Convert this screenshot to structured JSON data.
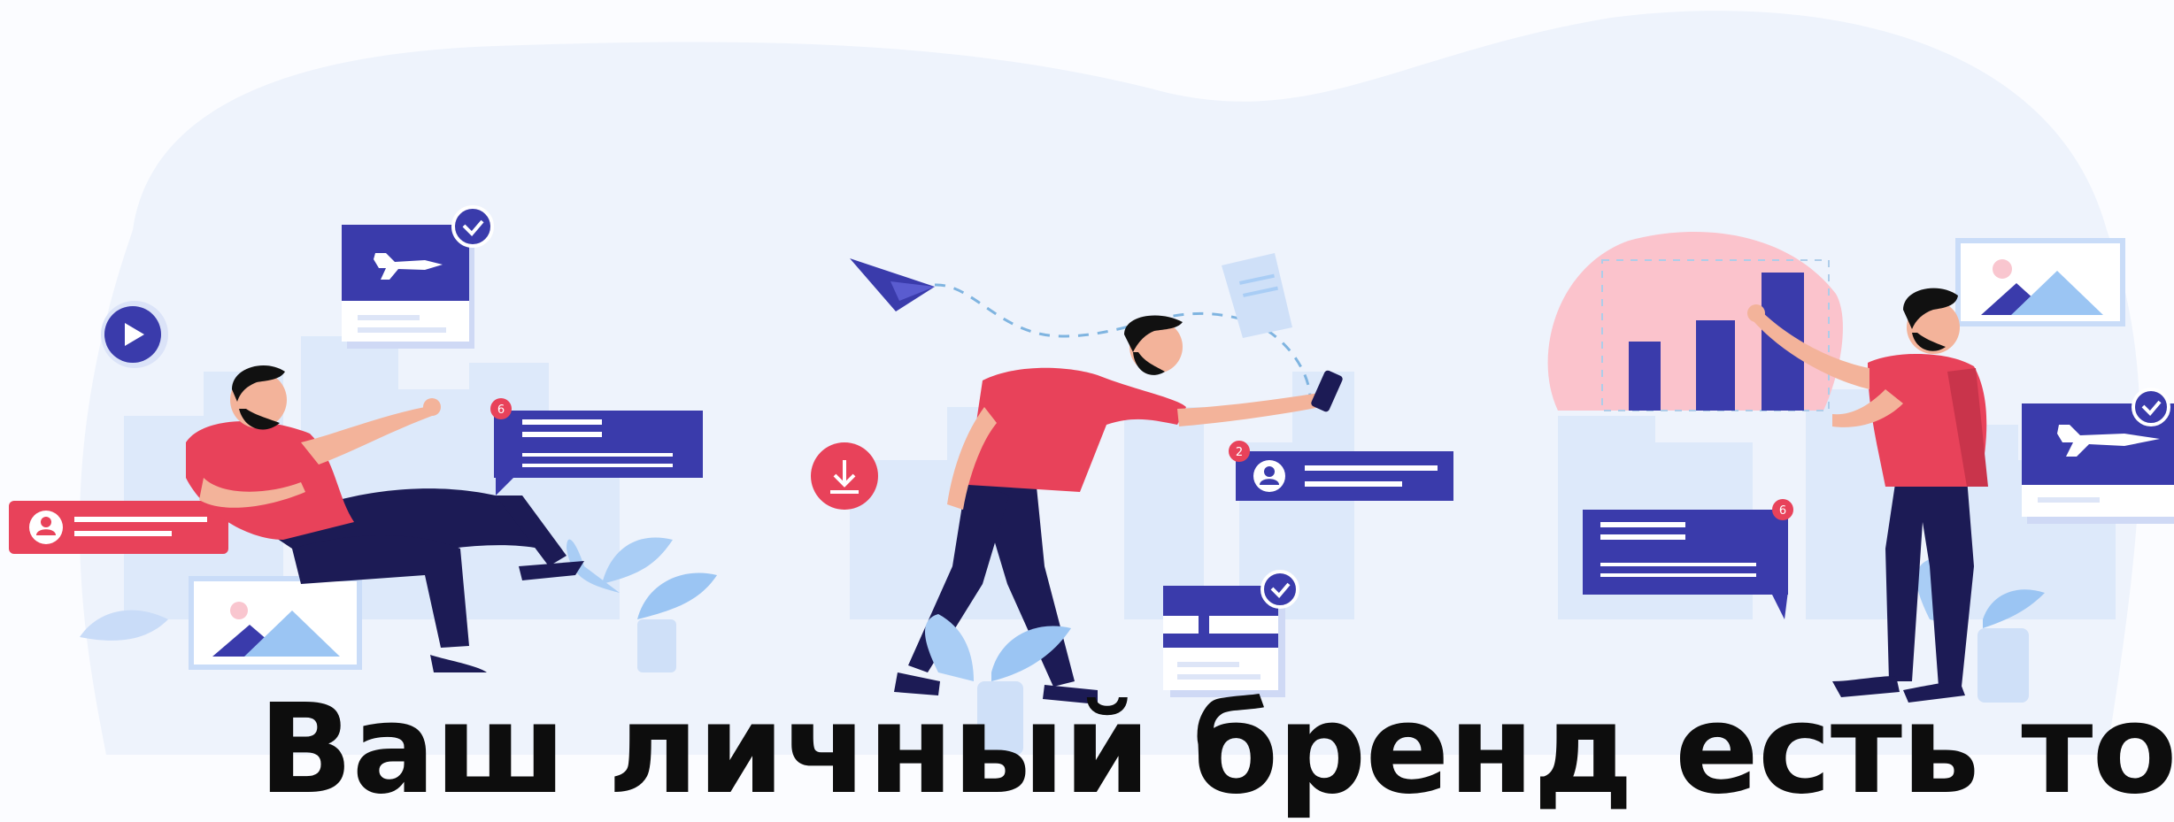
{
  "headline": "Ваш личный бренд есть то",
  "badges": {
    "left_bubble": "6",
    "center_bubble": "2",
    "right_bubble": "6"
  },
  "colors": {
    "background": "#fbfcff",
    "blob": "#eef3fc",
    "city": "#dde9fa",
    "accent_blue": "#3a3bab",
    "accent_red": "#e8425a",
    "pants_navy": "#1c1b55",
    "hair": "#111111",
    "skin": "#f3b39a",
    "leaf_light": "#a9cdf5",
    "pink_circle": "#fbc3cc"
  },
  "icons": [
    "play-icon",
    "download-icon",
    "paper-plane-icon",
    "airplane-icon",
    "check-icon",
    "user-icon",
    "image-icon",
    "bar-chart-icon"
  ]
}
